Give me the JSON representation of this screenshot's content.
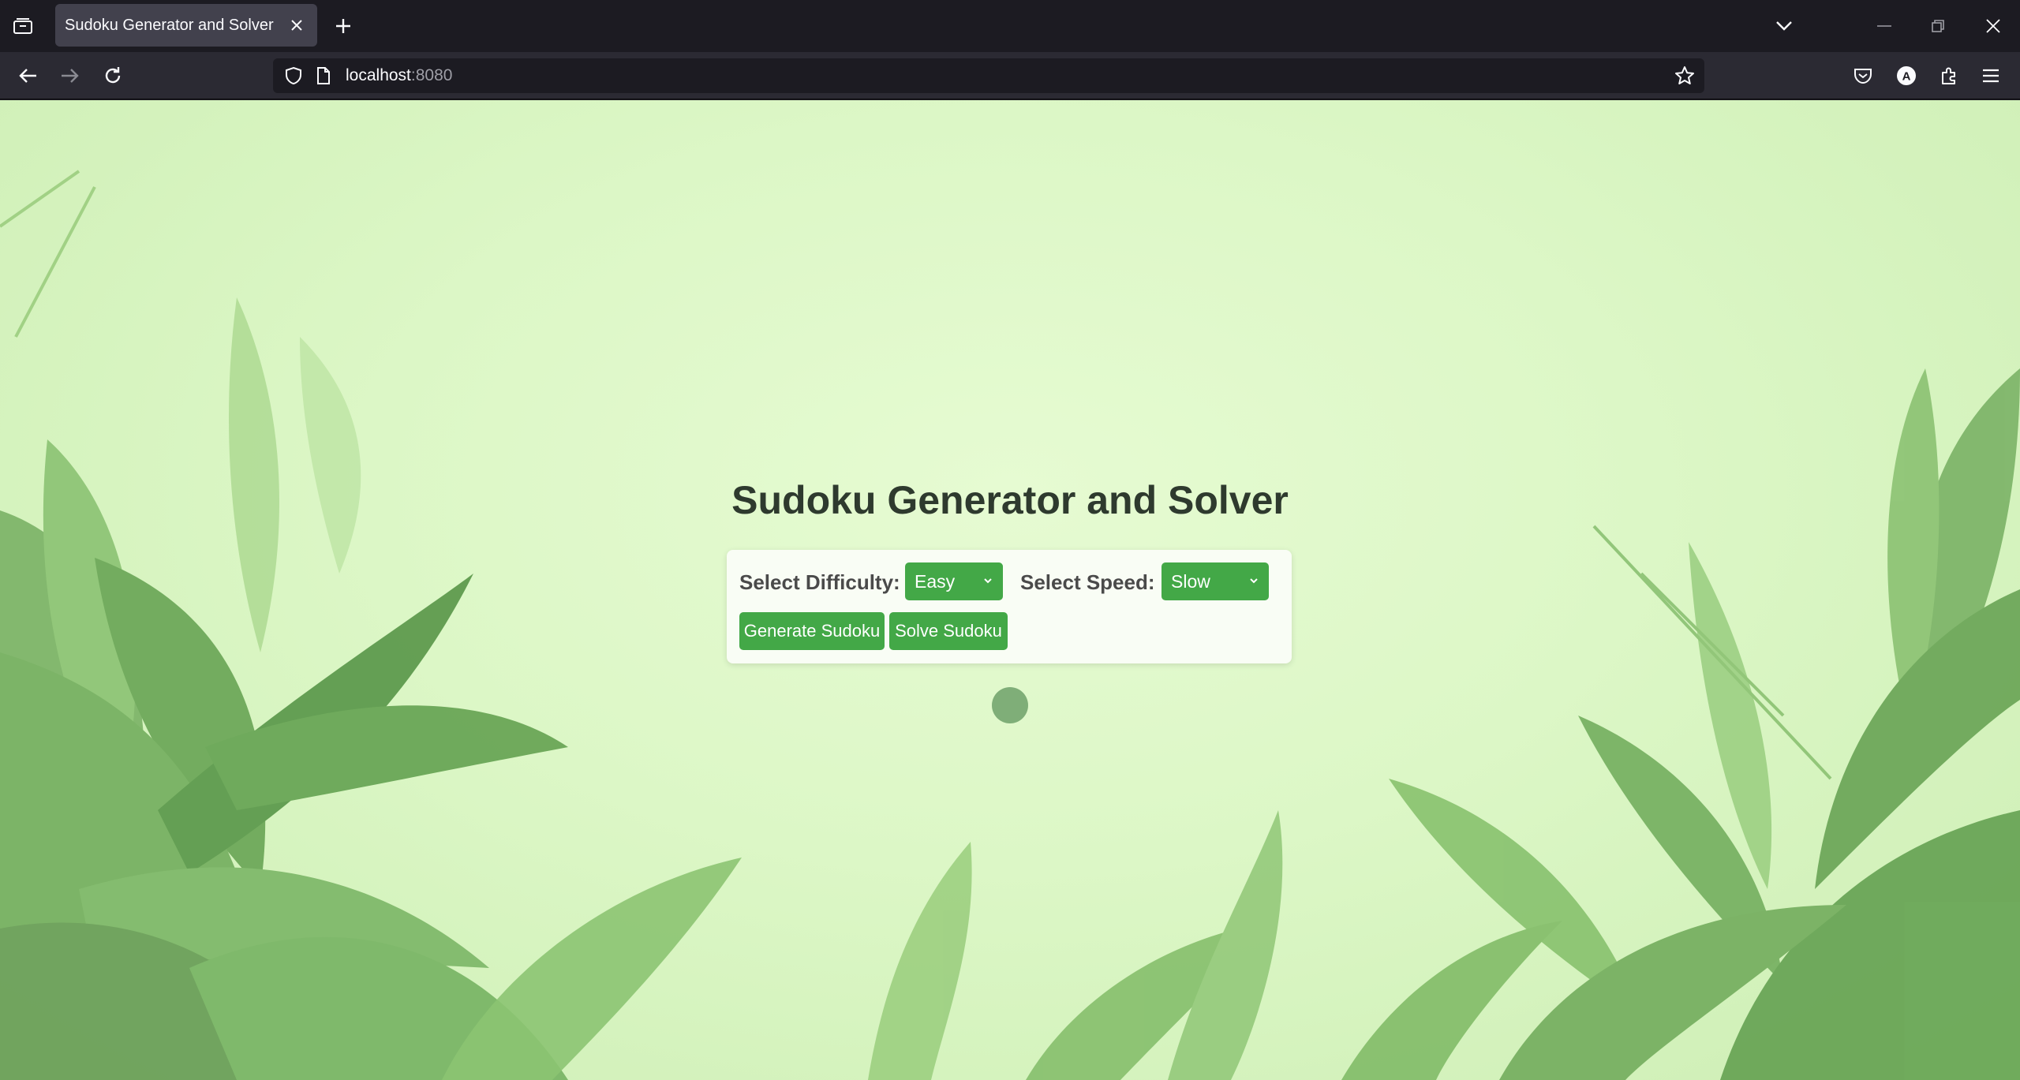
{
  "browser": {
    "tab_title": "Sudoku Generator and Solver",
    "url_host": "localhost",
    "url_port": ":8080",
    "account_initial": "A"
  },
  "page": {
    "title": "Sudoku Generator and Solver",
    "difficulty_label": "Select Difficulty:",
    "difficulty_value": "Easy",
    "speed_label": "Select Speed:",
    "speed_value": "Slow",
    "generate_label": "Generate Sudoku",
    "solve_label": "Solve Sudoku"
  },
  "colors": {
    "accent_green": "#43a847",
    "background": "#dcf7c6",
    "title_text": "#2e3a2e"
  },
  "icons": [
    "tab-list-icon",
    "close-icon",
    "plus-icon",
    "chevron-down-icon",
    "minimize-icon",
    "restore-icon",
    "back-icon",
    "forward-icon",
    "reload-icon",
    "shield-icon",
    "page-icon",
    "star-icon",
    "pocket-icon",
    "account-icon",
    "extensions-icon",
    "menu-icon"
  ]
}
